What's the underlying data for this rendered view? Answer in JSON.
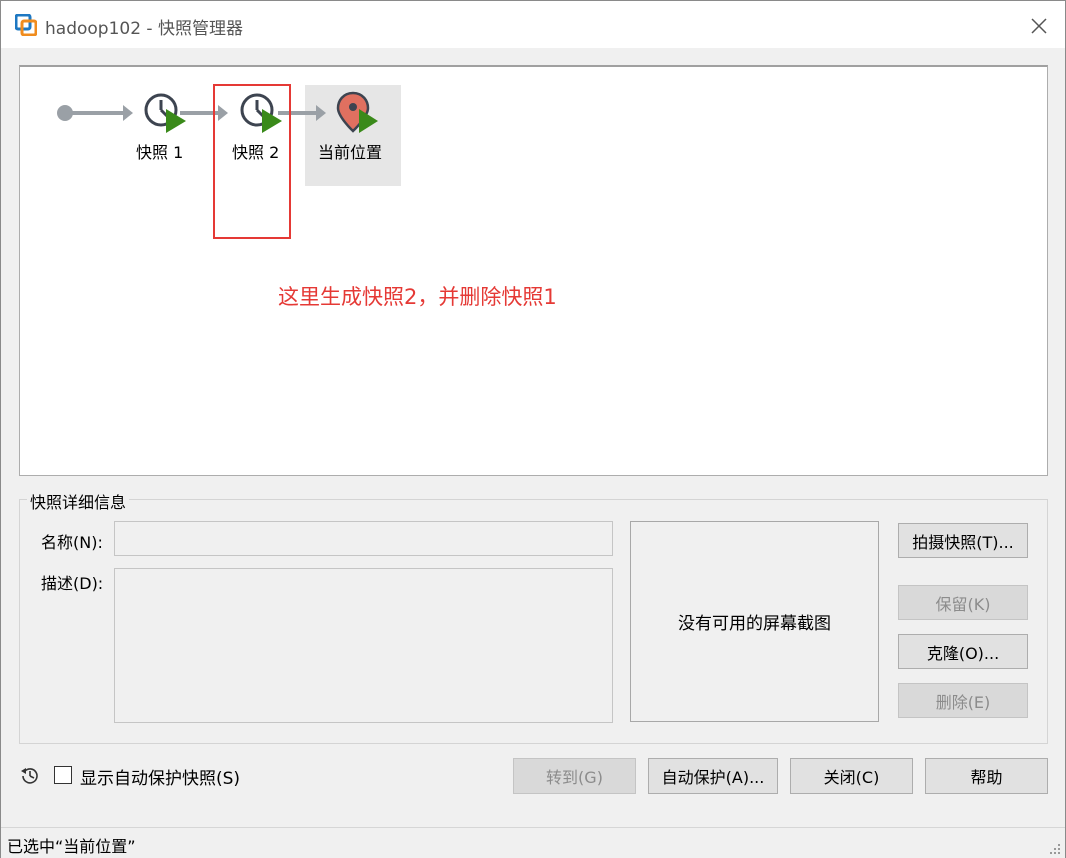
{
  "window": {
    "title": "hadoop102 - 快照管理器"
  },
  "tree": {
    "nodes": [
      {
        "label": "快照 1",
        "icon": "snapshot-clock-icon"
      },
      {
        "label": "快照 2",
        "icon": "snapshot-clock-icon"
      },
      {
        "label": "当前位置",
        "icon": "current-location-pin-icon"
      }
    ],
    "annotation": "这里生成快照2，并删除快照1",
    "annotation_color": "#e53935"
  },
  "details": {
    "legend": "快照详细信息",
    "name_label": "名称(N):",
    "name_value": "",
    "description_label": "描述(D):",
    "description_value": "",
    "screenshot_text": "没有可用的屏幕截图"
  },
  "side_buttons": {
    "take_snapshot": "拍摄快照(T)...",
    "keep": "保留(K)",
    "clone": "克隆(O)...",
    "delete": "删除(E)"
  },
  "bottom": {
    "show_autoprotect_label": "显示自动保护快照(S)",
    "show_autoprotect_checked": false,
    "goto": "转到(G)",
    "autoprotect": "自动保护(A)...",
    "close": "关闭(C)",
    "help": "帮助"
  },
  "status": {
    "text": "已选中“当前位置”"
  },
  "colors": {
    "accent_green": "#3a8a1a",
    "pin_red": "#e07060",
    "clock_gray": "#3d4450"
  }
}
